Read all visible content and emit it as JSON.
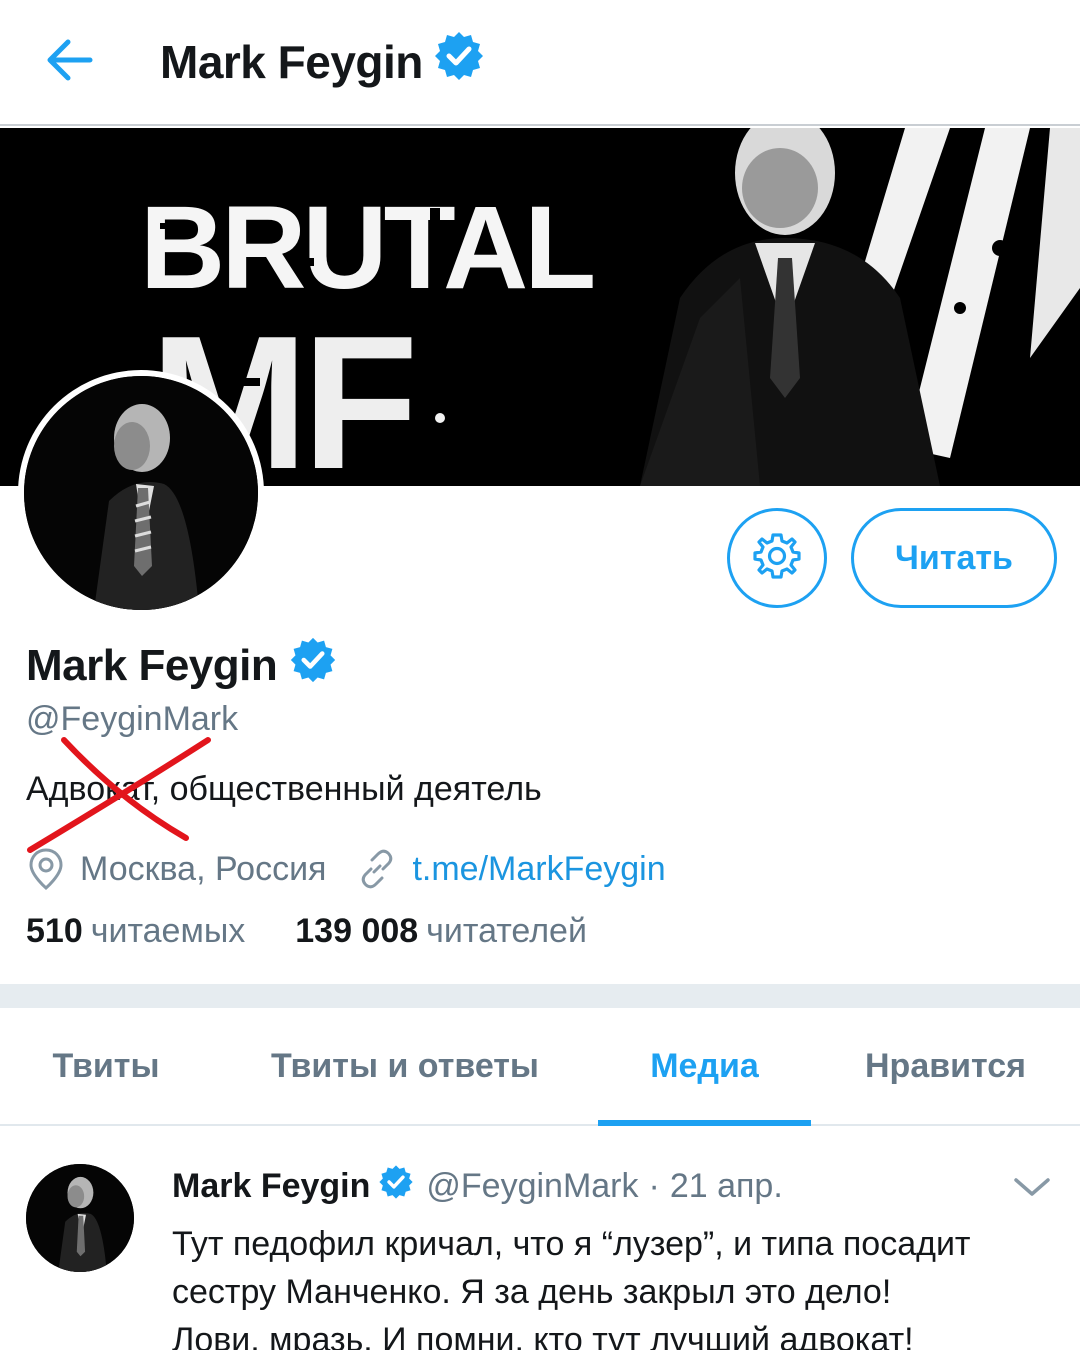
{
  "topbar": {
    "back_icon": "arrow-left-icon",
    "title": "Mark Feygin",
    "verified_icon": "verified-badge-icon"
  },
  "banner": {
    "text_line1": "BRUTAL",
    "text_line2": "MF"
  },
  "profile": {
    "name": "Mark Feygin",
    "handle": "@FeyginMark",
    "bio": "Адвокат, общественный деятель",
    "location_icon": "location-pin-icon",
    "location": "Москва, Россия",
    "link_icon": "link-icon",
    "link": "t.me/MarkFeygin",
    "settings_icon": "gear-icon",
    "follow_label": "Читать",
    "following_count": "510",
    "following_label": "читаемых",
    "followers_count": "139 008",
    "followers_label": "читателей"
  },
  "tabs": [
    {
      "label": "Твиты",
      "active": false
    },
    {
      "label": "Твиты и ответы",
      "active": false
    },
    {
      "label": "Медиа",
      "active": true
    },
    {
      "label": "Нравится",
      "active": false
    }
  ],
  "tweet": {
    "author": "Mark Feygin",
    "handle": "@FeyginMark",
    "separator": "·",
    "date": "21 апр.",
    "menu_icon": "chevron-down-icon",
    "text_line1": "Тут педофил кричал, что я “лузер”, и типа посадит",
    "text_line2": "сестру Манченко. Я за день закрыл это дело!",
    "text_line3": "Лови, мразь. И помни, кто тут лучший адвокат!"
  },
  "colors": {
    "accent": "#1da1f2",
    "link": "#1b95e0",
    "secondary_text": "#657786",
    "primary_text": "#14171a",
    "divider": "#e6ecf0",
    "scribble": "#e2151c"
  }
}
